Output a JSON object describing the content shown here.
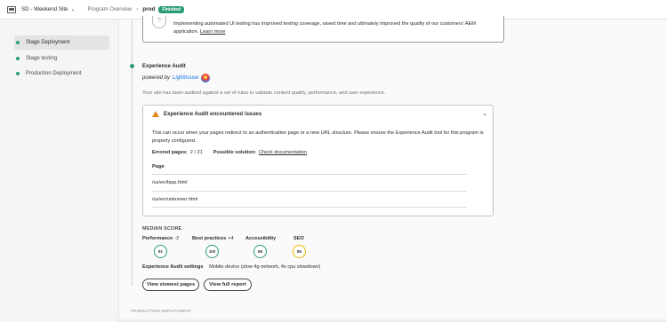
{
  "header": {
    "project": "SD - Weekend Site",
    "breadcrumb": "Program Overview",
    "environment": "prod",
    "status": "Finished"
  },
  "sidebar": {
    "items": [
      {
        "label": "Stage Deployment",
        "active": true
      },
      {
        "label": "Stage testing",
        "active": false
      },
      {
        "label": "Production Deployment",
        "active": false
      }
    ]
  },
  "insight": {
    "text": "Implementing automated UI testing has improved testing coverage, saved time and ultimately improved the quality of our customers' AEM application.",
    "link": "Learn more"
  },
  "audit": {
    "title": "Experience Audit",
    "powered_by": "powered by",
    "powered_by_name": "Lighthouse",
    "description": "Your site has been audited against a set of rules to validate content quality, performance, and user experience.",
    "issue_title": "Experience Audit encountered issues",
    "issue_body": "This can occur when your pages redirect to an authentication page or a new URL structure. Please ensure the Experience Audit tool for this program is properly configured.",
    "errored_label": "Errored pages:",
    "errored_value": "2 / 21",
    "solution_label": "Possible solution:",
    "solution_link": "Check documentation",
    "page_header": "Page",
    "pages": [
      "/us/en/faqs.html",
      "/us/en/unknown.html"
    ],
    "median_label": "MEDIAN SCORE",
    "scores": [
      {
        "label": "Performance",
        "delta": "-2",
        "value": "91"
      },
      {
        "label": "Best practices",
        "delta": "+4",
        "value": "100"
      },
      {
        "label": "Accessibility",
        "delta": "",
        "value": "98"
      },
      {
        "label": "SEO",
        "delta": "",
        "value": "85"
      }
    ],
    "settings_label": "Experience Audit settings",
    "settings_value": "Mobile device (slow 4g network, 4x cpu slowdown)",
    "btn_slowest": "View slowest pages",
    "btn_report": "View full report"
  },
  "footer": {
    "next_section": "PRODUCTION DEPLOYMENT"
  },
  "colors": {
    "accent": "#2d9d78",
    "warning": "#e68619",
    "score_warn": "#e6b800"
  }
}
